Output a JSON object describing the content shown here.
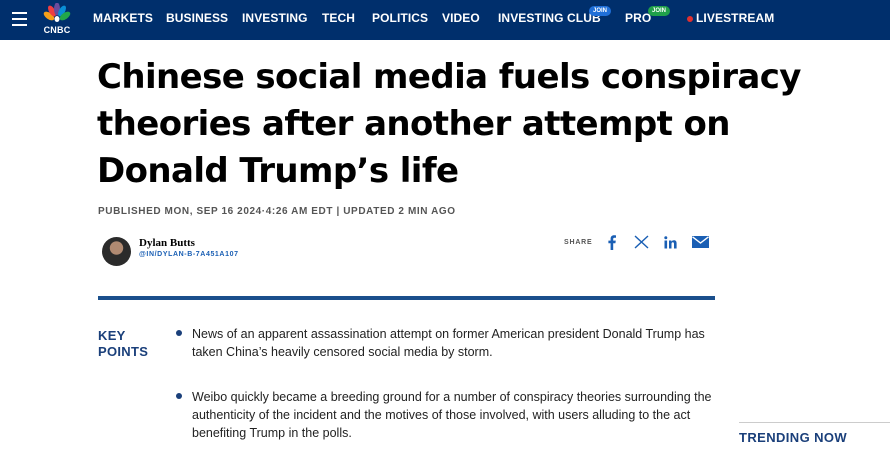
{
  "nav": {
    "logo_text": "CNBC",
    "items": [
      {
        "label": "MARKETS"
      },
      {
        "label": "BUSINESS"
      },
      {
        "label": "INVESTING"
      },
      {
        "label": "TECH"
      },
      {
        "label": "POLITICS"
      },
      {
        "label": "VIDEO"
      },
      {
        "label": "INVESTING CLUB",
        "badge": "JOIN"
      },
      {
        "label": "PRO",
        "badge": "JOIN"
      },
      {
        "label": "LIVESTREAM"
      }
    ],
    "colors": {
      "bar": "#002f6c",
      "investing_club_badge": "#1f6fd8",
      "pro_badge": "#20a04a",
      "live_dot": "#e03030"
    }
  },
  "article": {
    "headline_lines": [
      "Chinese social media fuels conspiracy",
      "theories after another attempt on",
      "Donald Trump’s life"
    ],
    "published": "PUBLISHED MON, SEP 16 2024·4:26 AM EDT | UPDATED 2 MIN AGO",
    "author": {
      "name": "Dylan Butts",
      "handle": "@IN/DYLAN-B-7A451A107"
    },
    "share": {
      "label": "SHARE",
      "icons": [
        "facebook-icon",
        "x-icon",
        "linkedin-icon",
        "email-icon"
      ]
    },
    "key_points": {
      "label_line1": "KEY",
      "label_line2": "POINTS",
      "items": [
        "News of an apparent assassination attempt on former American president Donald Trump has taken China’s heavily censored social media by storm.",
        "Weibo quickly became a breeding ground for a number of conspiracy theories surrounding the authenticity of the incident and the motives of those involved, with users alluding to the act benefiting Trump in the polls."
      ]
    }
  },
  "sidebar": {
    "trending_label": "TRENDING NOW"
  }
}
